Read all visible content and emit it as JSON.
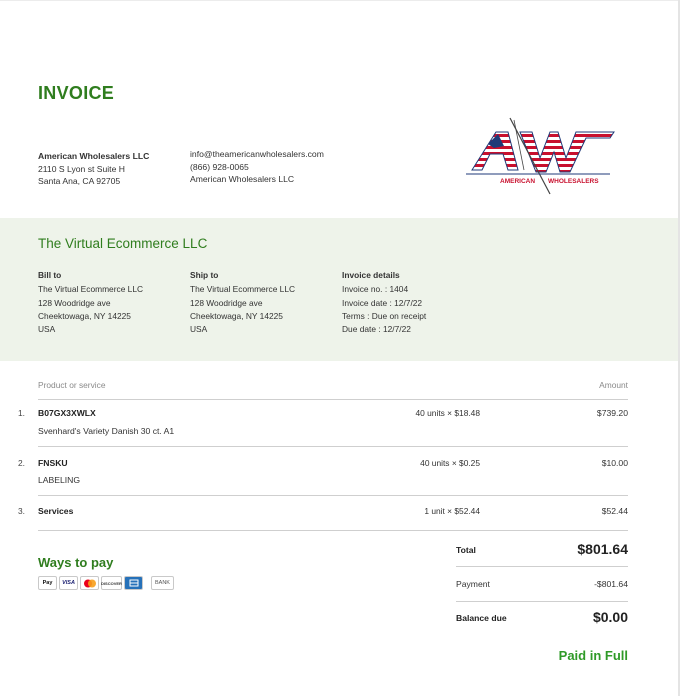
{
  "invoice": {
    "title": "INVOICE",
    "seller": {
      "name": "American Wholesalers LLC",
      "address_line1": "2110 S Lyon st Suite H",
      "address_line2": "Santa Ana, CA 92705",
      "email": "info@theamericanwholesalers.com",
      "phone": "(866) 928-0065",
      "company": "American Wholesalers LLC"
    },
    "logo": {
      "letters": "AW",
      "caption_left": "AMERICAN",
      "caption_right": "WHOLESALERS"
    },
    "customer_name": "The Virtual Ecommerce LLC",
    "bill_to": {
      "heading": "Bill to",
      "lines": [
        "The Virtual Ecommerce LLC",
        "128 Woodridge ave",
        "Cheektowaga, NY 14225",
        "USA"
      ]
    },
    "ship_to": {
      "heading": "Ship to",
      "lines": [
        "The Virtual Ecommerce LLC",
        "128 Woodridge ave",
        "Cheektowaga, NY 14225",
        "USA"
      ]
    },
    "details": {
      "heading": "Invoice details",
      "lines": [
        "Invoice no. : 1404",
        "Invoice date : 12/7/22",
        "Terms : Due on receipt",
        "Due date : 12/7/22"
      ]
    },
    "table": {
      "col_product": "Product or service",
      "col_amount": "Amount",
      "rows": [
        {
          "num": "1.",
          "name": "B07GX3XWLX",
          "desc": "Svenhard's Variety Danish 30 ct. A1",
          "qty": "40 units × $18.48",
          "amount": "$739.20"
        },
        {
          "num": "2.",
          "name": "FNSKU",
          "desc": "LABELING",
          "qty": "40 units × $0.25",
          "amount": "$10.00"
        },
        {
          "num": "3.",
          "name": "Services",
          "desc": "",
          "qty": "1 unit × $52.44",
          "amount": "$52.44"
        }
      ]
    },
    "ways_to_pay": {
      "heading": "Ways to pay",
      "methods": [
        "Pay",
        "VISA",
        "mastercard",
        "DISCOVER",
        "AMEX",
        "BANK"
      ]
    },
    "summary": {
      "total_label": "Total",
      "total_value": "$801.64",
      "payment_label": "Payment",
      "payment_value": "-$801.64",
      "balance_label": "Balance due",
      "balance_value": "$0.00",
      "status": "Paid in Full"
    },
    "colors": {
      "accent": "#2f7d1e",
      "band": "#eef3ea",
      "paid": "#2f9a27",
      "flag_red": "#c8102e",
      "flag_blue": "#1f3a78"
    }
  }
}
